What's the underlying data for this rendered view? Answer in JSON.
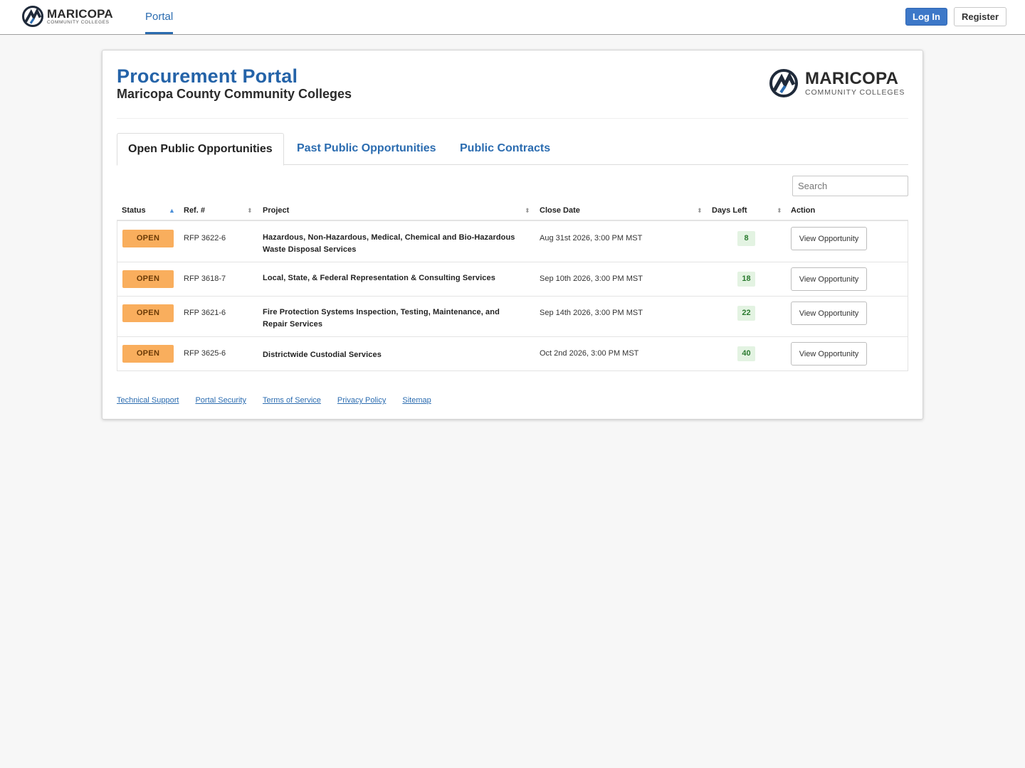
{
  "nav": {
    "logo": {
      "name": "MARICOPA",
      "sub": "COMMUNITY COLLEGES"
    },
    "portal_link": "Portal",
    "login_label": "Log In",
    "register_label": "Register"
  },
  "header": {
    "title": "Procurement Portal",
    "subtitle": "Maricopa County Community Colleges",
    "logo": {
      "name": "MARICOPA",
      "sub": "COMMUNITY COLLEGES"
    }
  },
  "tabs": [
    {
      "label": "Open Public Opportunities",
      "active": true
    },
    {
      "label": "Past Public Opportunities",
      "active": false
    },
    {
      "label": "Public Contracts",
      "active": false
    }
  ],
  "search": {
    "placeholder": "Search"
  },
  "table": {
    "columns": [
      "Status",
      "Ref. #",
      "Project",
      "Close Date",
      "Days Left",
      "Action"
    ],
    "rows": [
      {
        "status": "OPEN",
        "ref": "RFP 3622-6",
        "project": "Hazardous, Non-Hazardous, Medical, Chemical and Bio-Hazardous Waste Disposal Services",
        "close": "Aug 31st 2026, 3:00 PM MST",
        "days": "8",
        "action": "View Opportunity"
      },
      {
        "status": "OPEN",
        "ref": "RFP 3618-7",
        "project": "Local, State, & Federal Representation & Consulting Services",
        "close": "Sep 10th 2026, 3:00 PM MST",
        "days": "18",
        "action": "View Opportunity"
      },
      {
        "status": "OPEN",
        "ref": "RFP 3621-6",
        "project": "Fire Protection Systems Inspection, Testing, Maintenance, and Repair Services",
        "close": "Sep 14th 2026, 3:00 PM MST",
        "days": "22",
        "action": "View Opportunity"
      },
      {
        "status": "OPEN",
        "ref": "RFP 3625-6",
        "project": "Districtwide Custodial Services",
        "close": "Oct 2nd 2026, 3:00 PM MST",
        "days": "40",
        "action": "View Opportunity"
      }
    ]
  },
  "footer": [
    "Technical Support",
    "Portal Security",
    "Terms of Service",
    "Privacy Policy",
    "Sitemap"
  ],
  "colors": {
    "brand_blue": "#2463a8",
    "status_open": "#f9ae5d",
    "days_bg": "#e3f3e2",
    "days_text": "#2a7a2f"
  },
  "icons": {
    "logo_mark": "maricopa-logo-icon",
    "sort": "sort-arrows-icon"
  }
}
